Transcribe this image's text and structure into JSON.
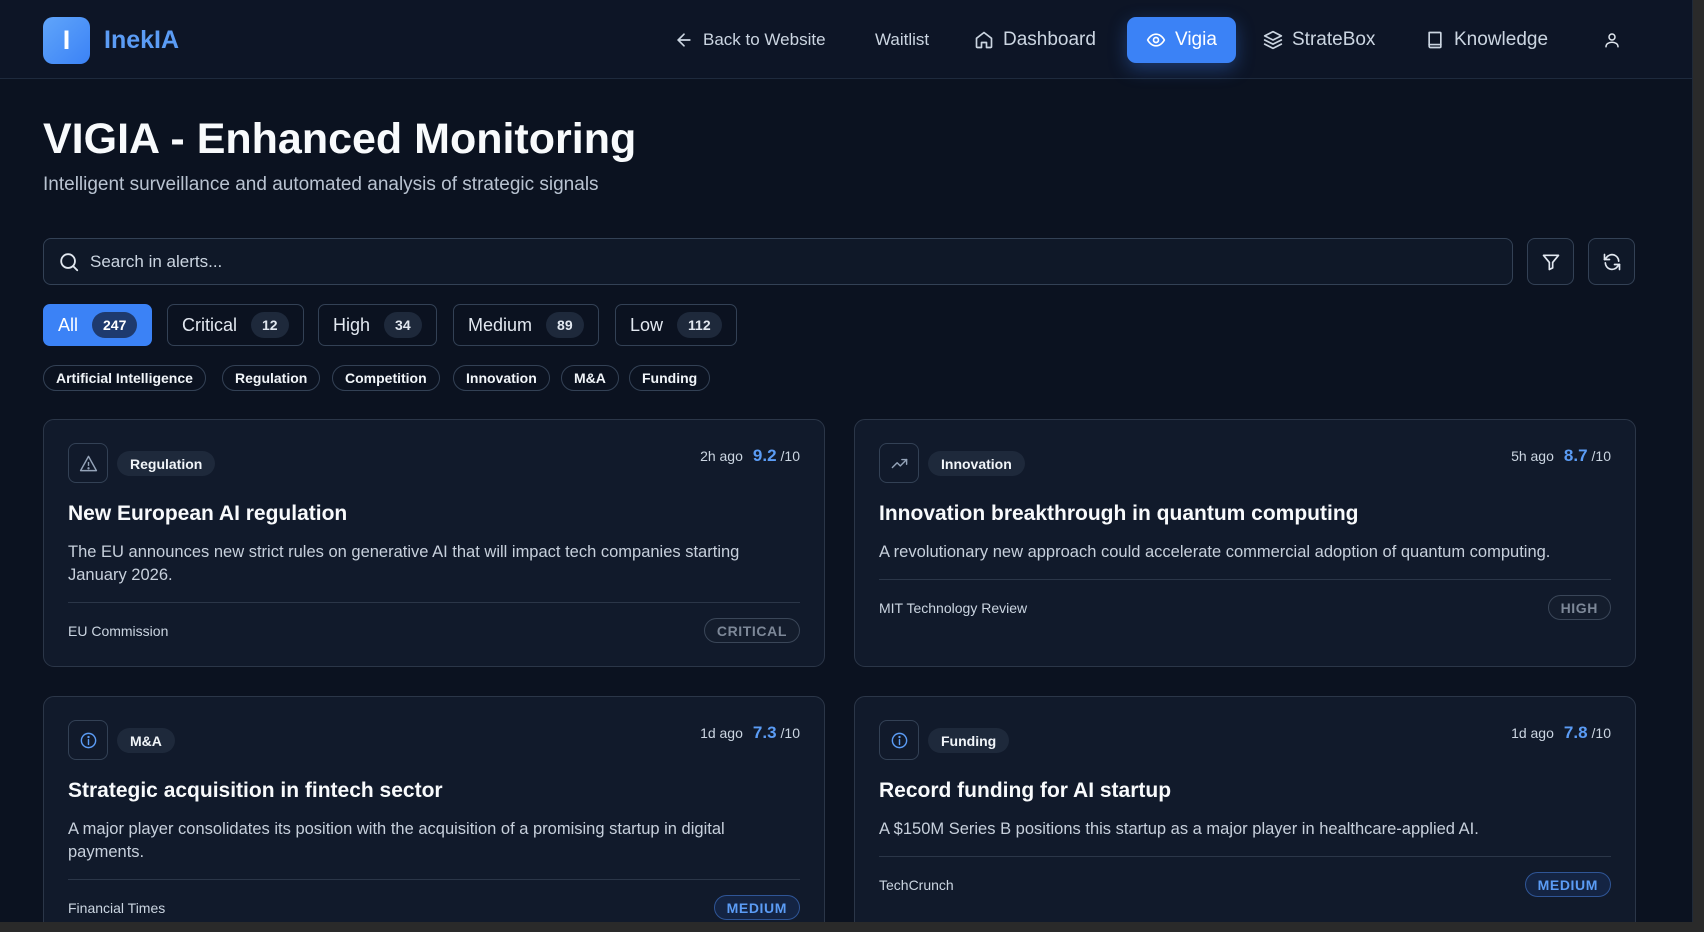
{
  "brand": {
    "logo_letter": "I",
    "name": "InekIA"
  },
  "nav": {
    "back_label": "Back to Website",
    "waitlist_label": "Waitlist",
    "dashboard_label": "Dashboard",
    "vigia_label": "Vigia",
    "stratebox_label": "StrateBox",
    "knowledge_label": "Knowledge"
  },
  "page": {
    "title": "VIGIA - Enhanced Monitoring",
    "subtitle": "Intelligent surveillance and automated analysis of strategic signals"
  },
  "search": {
    "placeholder": "Search in alerts..."
  },
  "severity_tabs": [
    {
      "label": "All",
      "count": "247",
      "active": true
    },
    {
      "label": "Critical",
      "count": "12"
    },
    {
      "label": "High",
      "count": "34"
    },
    {
      "label": "Medium",
      "count": "89"
    },
    {
      "label": "Low",
      "count": "112"
    }
  ],
  "categories": [
    "Artificial Intelligence",
    "Regulation",
    "Competition",
    "Innovation",
    "M&A",
    "Funding"
  ],
  "alerts": [
    {
      "icon": "warning-triangle-icon",
      "category": "Regulation",
      "time": "2h ago",
      "score": "9.2",
      "score_suffix": "/10",
      "title": "New European AI regulation",
      "description": "The EU announces new strict rules on generative AI that will impact tech companies starting January 2026.",
      "source": "EU Commission",
      "severity": "CRITICAL"
    },
    {
      "icon": "trending-up-icon",
      "category": "Innovation",
      "time": "5h ago",
      "score": "8.7",
      "score_suffix": "/10",
      "title": "Innovation breakthrough in quantum computing",
      "description": "A revolutionary new approach could accelerate commercial adoption of quantum computing.",
      "source": "MIT Technology Review",
      "severity": "HIGH"
    },
    {
      "icon": "info-icon",
      "category": "M&A",
      "time": "1d ago",
      "score": "7.3",
      "score_suffix": "/10",
      "title": "Strategic acquisition in fintech sector",
      "description": "A major player consolidates its position with the acquisition of a promising startup in digital payments.",
      "source": "Financial Times",
      "severity": "MEDIUM"
    },
    {
      "icon": "info-icon",
      "category": "Funding",
      "time": "1d ago",
      "score": "7.8",
      "score_suffix": "/10",
      "title": "Record funding for AI startup",
      "description": "A $150M Series B positions this startup as a major player in healthcare-applied AI.",
      "source": "TechCrunch",
      "severity": "MEDIUM"
    }
  ],
  "colors": {
    "accent": "#3b82f6",
    "background": "#0b1220",
    "card": "#111a2b"
  }
}
